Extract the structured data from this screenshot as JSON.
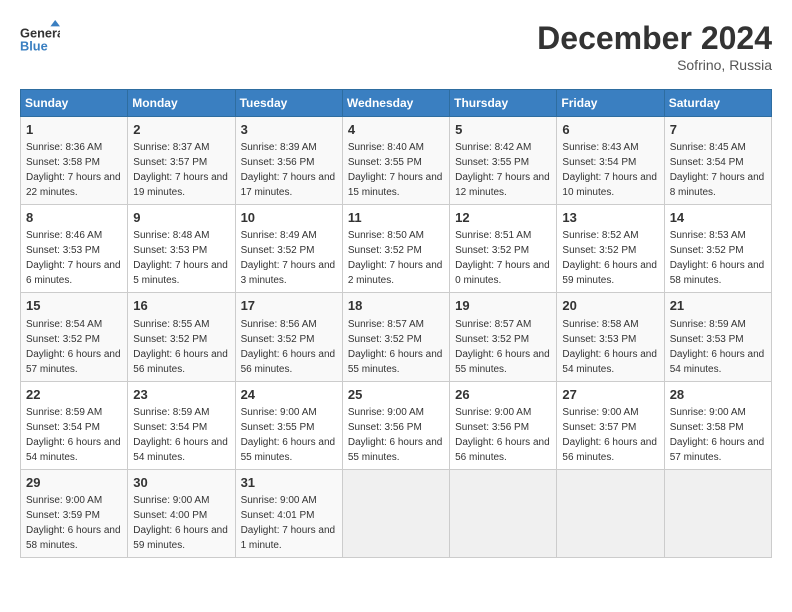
{
  "header": {
    "logo_line1": "General",
    "logo_line2": "Blue",
    "month": "December 2024",
    "location": "Sofrino, Russia"
  },
  "weekdays": [
    "Sunday",
    "Monday",
    "Tuesday",
    "Wednesday",
    "Thursday",
    "Friday",
    "Saturday"
  ],
  "weeks": [
    [
      {
        "day": 1,
        "sunrise": "8:36 AM",
        "sunset": "3:58 PM",
        "daylight": "7 hours and 22 minutes."
      },
      {
        "day": 2,
        "sunrise": "8:37 AM",
        "sunset": "3:57 PM",
        "daylight": "7 hours and 19 minutes."
      },
      {
        "day": 3,
        "sunrise": "8:39 AM",
        "sunset": "3:56 PM",
        "daylight": "7 hours and 17 minutes."
      },
      {
        "day": 4,
        "sunrise": "8:40 AM",
        "sunset": "3:55 PM",
        "daylight": "7 hours and 15 minutes."
      },
      {
        "day": 5,
        "sunrise": "8:42 AM",
        "sunset": "3:55 PM",
        "daylight": "7 hours and 12 minutes."
      },
      {
        "day": 6,
        "sunrise": "8:43 AM",
        "sunset": "3:54 PM",
        "daylight": "7 hours and 10 minutes."
      },
      {
        "day": 7,
        "sunrise": "8:45 AM",
        "sunset": "3:54 PM",
        "daylight": "7 hours and 8 minutes."
      }
    ],
    [
      {
        "day": 8,
        "sunrise": "8:46 AM",
        "sunset": "3:53 PM",
        "daylight": "7 hours and 6 minutes."
      },
      {
        "day": 9,
        "sunrise": "8:48 AM",
        "sunset": "3:53 PM",
        "daylight": "7 hours and 5 minutes."
      },
      {
        "day": 10,
        "sunrise": "8:49 AM",
        "sunset": "3:52 PM",
        "daylight": "7 hours and 3 minutes."
      },
      {
        "day": 11,
        "sunrise": "8:50 AM",
        "sunset": "3:52 PM",
        "daylight": "7 hours and 2 minutes."
      },
      {
        "day": 12,
        "sunrise": "8:51 AM",
        "sunset": "3:52 PM",
        "daylight": "7 hours and 0 minutes."
      },
      {
        "day": 13,
        "sunrise": "8:52 AM",
        "sunset": "3:52 PM",
        "daylight": "6 hours and 59 minutes."
      },
      {
        "day": 14,
        "sunrise": "8:53 AM",
        "sunset": "3:52 PM",
        "daylight": "6 hours and 58 minutes."
      }
    ],
    [
      {
        "day": 15,
        "sunrise": "8:54 AM",
        "sunset": "3:52 PM",
        "daylight": "6 hours and 57 minutes."
      },
      {
        "day": 16,
        "sunrise": "8:55 AM",
        "sunset": "3:52 PM",
        "daylight": "6 hours and 56 minutes."
      },
      {
        "day": 17,
        "sunrise": "8:56 AM",
        "sunset": "3:52 PM",
        "daylight": "6 hours and 56 minutes."
      },
      {
        "day": 18,
        "sunrise": "8:57 AM",
        "sunset": "3:52 PM",
        "daylight": "6 hours and 55 minutes."
      },
      {
        "day": 19,
        "sunrise": "8:57 AM",
        "sunset": "3:52 PM",
        "daylight": "6 hours and 55 minutes."
      },
      {
        "day": 20,
        "sunrise": "8:58 AM",
        "sunset": "3:53 PM",
        "daylight": "6 hours and 54 minutes."
      },
      {
        "day": 21,
        "sunrise": "8:59 AM",
        "sunset": "3:53 PM",
        "daylight": "6 hours and 54 minutes."
      }
    ],
    [
      {
        "day": 22,
        "sunrise": "8:59 AM",
        "sunset": "3:54 PM",
        "daylight": "6 hours and 54 minutes."
      },
      {
        "day": 23,
        "sunrise": "8:59 AM",
        "sunset": "3:54 PM",
        "daylight": "6 hours and 54 minutes."
      },
      {
        "day": 24,
        "sunrise": "9:00 AM",
        "sunset": "3:55 PM",
        "daylight": "6 hours and 55 minutes."
      },
      {
        "day": 25,
        "sunrise": "9:00 AM",
        "sunset": "3:56 PM",
        "daylight": "6 hours and 55 minutes."
      },
      {
        "day": 26,
        "sunrise": "9:00 AM",
        "sunset": "3:56 PM",
        "daylight": "6 hours and 56 minutes."
      },
      {
        "day": 27,
        "sunrise": "9:00 AM",
        "sunset": "3:57 PM",
        "daylight": "6 hours and 56 minutes."
      },
      {
        "day": 28,
        "sunrise": "9:00 AM",
        "sunset": "3:58 PM",
        "daylight": "6 hours and 57 minutes."
      }
    ],
    [
      {
        "day": 29,
        "sunrise": "9:00 AM",
        "sunset": "3:59 PM",
        "daylight": "6 hours and 58 minutes."
      },
      {
        "day": 30,
        "sunrise": "9:00 AM",
        "sunset": "4:00 PM",
        "daylight": "6 hours and 59 minutes."
      },
      {
        "day": 31,
        "sunrise": "9:00 AM",
        "sunset": "4:01 PM",
        "daylight": "7 hours and 1 minute."
      },
      null,
      null,
      null,
      null
    ]
  ]
}
